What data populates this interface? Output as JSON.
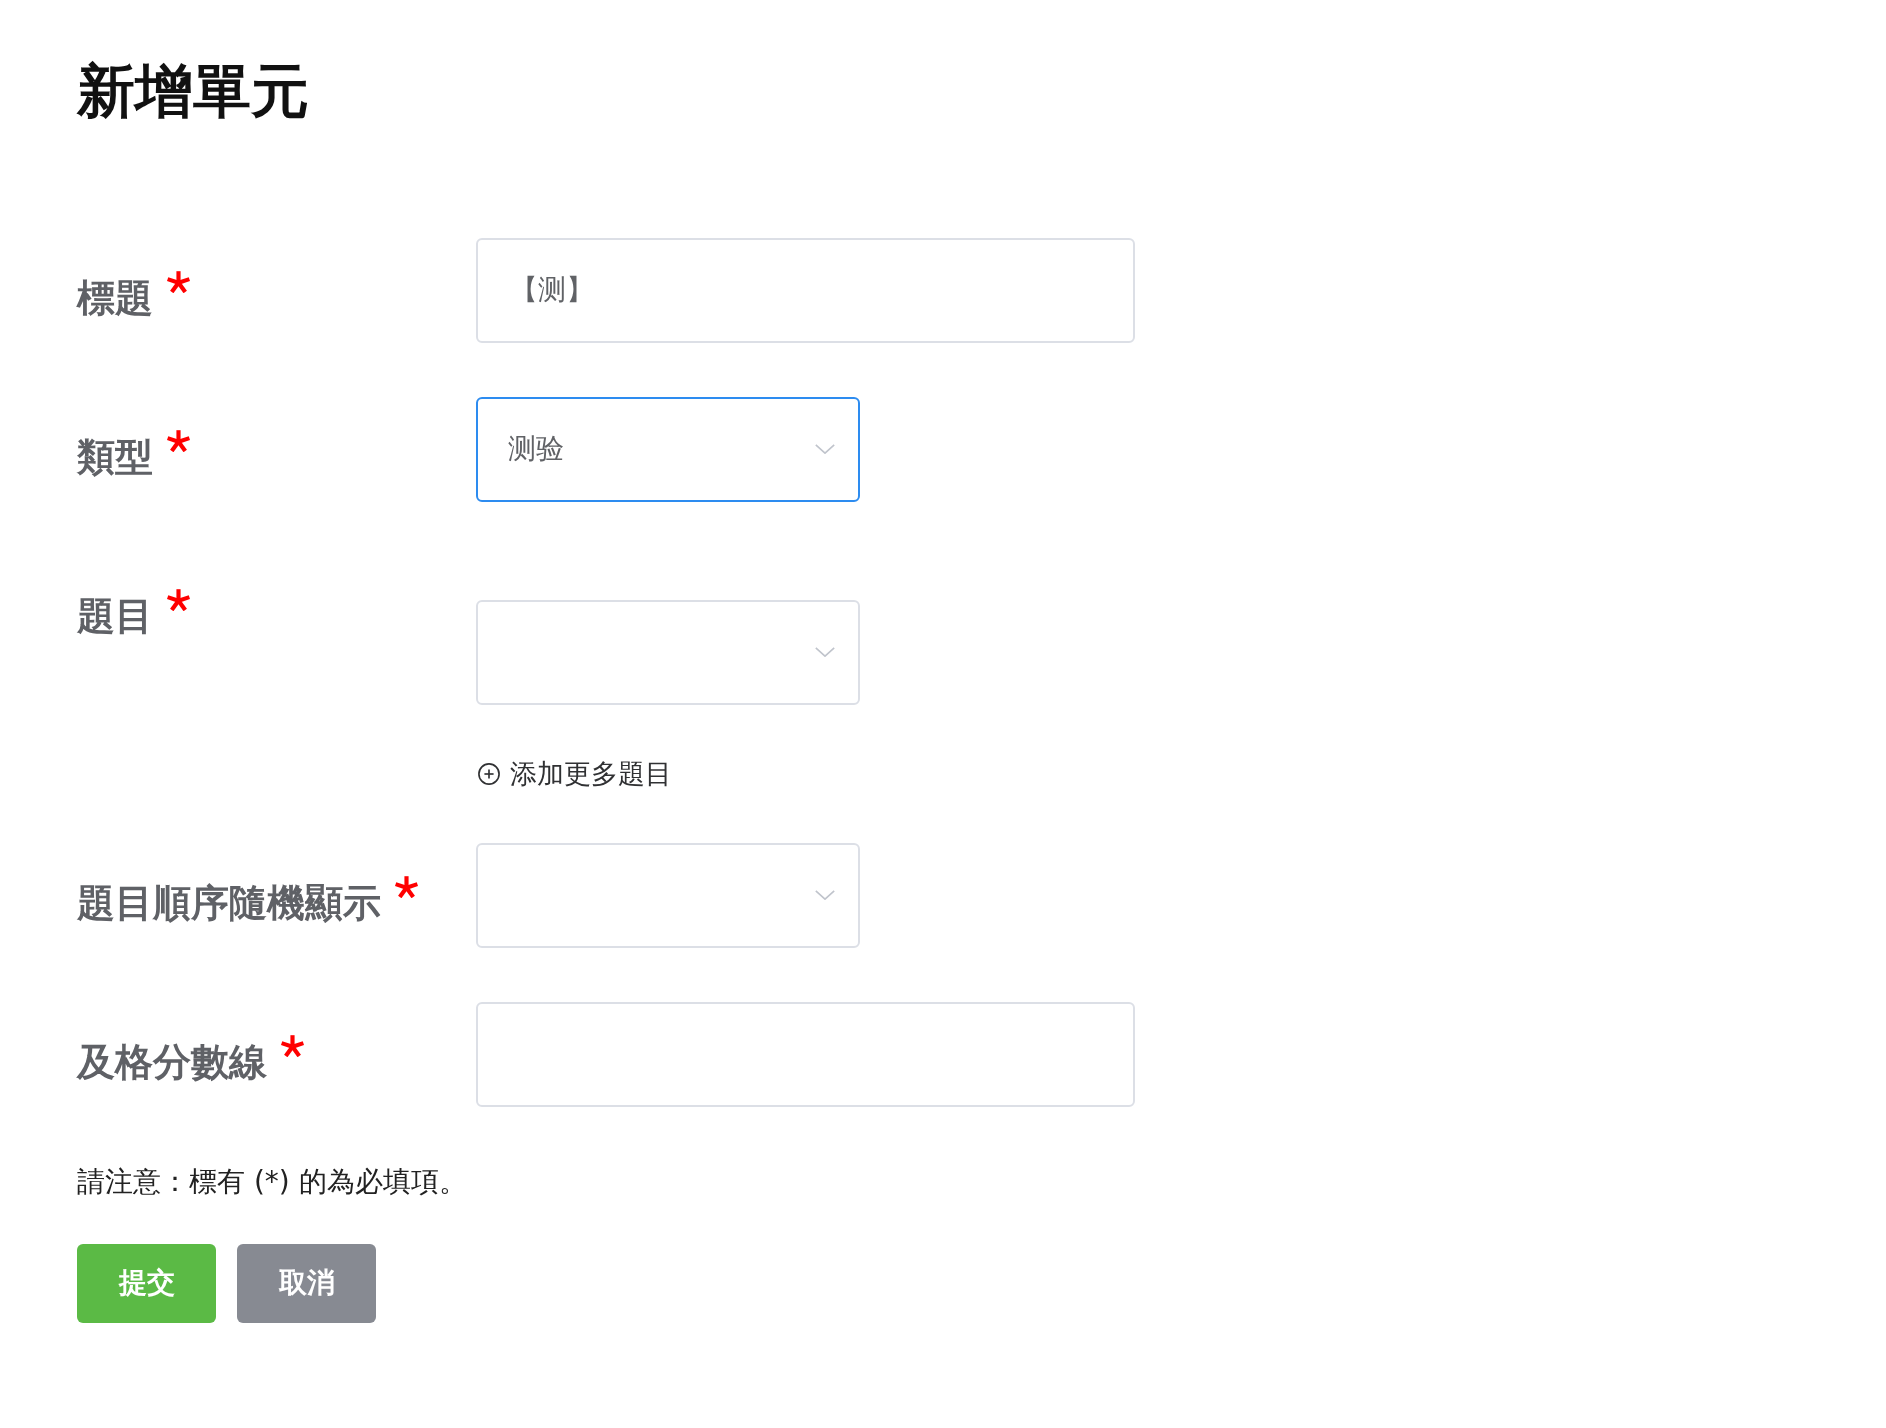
{
  "page": {
    "title": "新增單元"
  },
  "form": {
    "fields": [
      {
        "kind": "text",
        "label": "標題",
        "required": true,
        "focused": false,
        "value": "【测】"
      },
      {
        "kind": "select",
        "label": "類型",
        "required": true,
        "focused": true,
        "value": "测验"
      },
      {
        "kind": "select",
        "label": "題目",
        "required": true,
        "focused": false,
        "add_link": {
          "label": "添加更多題目"
        }
      },
      {
        "kind": "select",
        "label": "題目順序隨機顯示",
        "required": true,
        "focused": false
      },
      {
        "kind": "text",
        "label": "及格分數線",
        "required": true,
        "focused": false
      }
    ],
    "note": "請注意：標有 (*) 的為必填項。",
    "buttons": [
      {
        "kind": "primary",
        "label": "提交"
      },
      {
        "kind": "secondary",
        "label": "取消"
      }
    ]
  }
}
